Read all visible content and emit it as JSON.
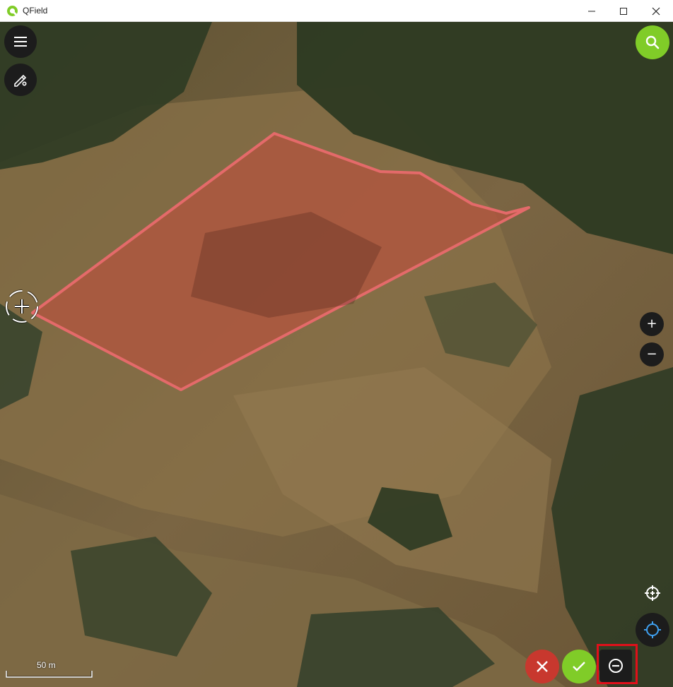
{
  "window": {
    "title": "QField",
    "controls": [
      "minimize-icon",
      "maximize-icon",
      "close-icon"
    ]
  },
  "map": {
    "basemap": "aerial-imagery",
    "feature": {
      "fill": "#b5533e",
      "stroke": "#e46a6a"
    },
    "scale_label": "50 m"
  },
  "buttons": {
    "menu": "menu-icon",
    "digitize_settings": "pencil-gear-icon",
    "search": "search-icon",
    "zoom_in": "+",
    "zoom_out": "−",
    "add_vertex": "crosshair-plus-icon",
    "gps": "gps-icon",
    "cancel": "close-icon",
    "confirm": "check-icon",
    "remove_vertex": "minus-circle-icon"
  },
  "colors": {
    "accent_green": "#80cc28",
    "cancel_red": "#c8382e",
    "highlight": "#e0101a"
  }
}
